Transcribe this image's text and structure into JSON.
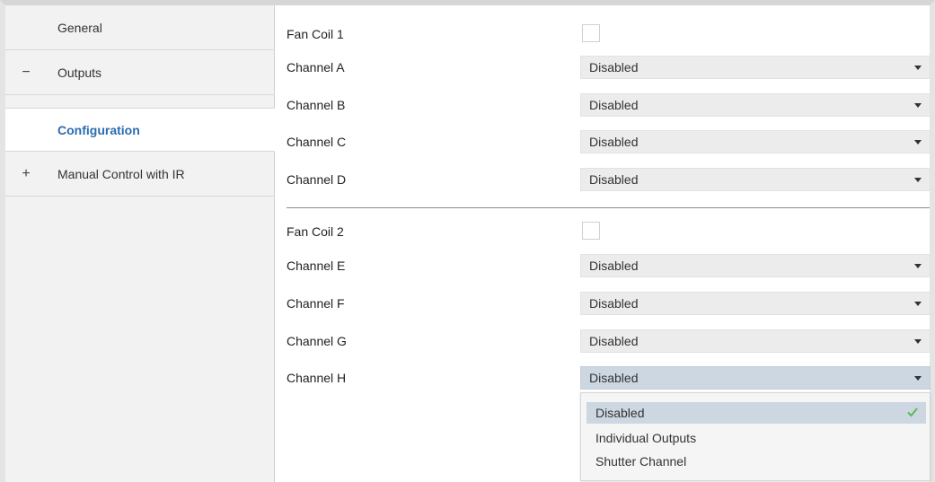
{
  "sidebar": {
    "items": [
      {
        "sign": "",
        "label": "General"
      },
      {
        "sign": "−",
        "label": "Outputs"
      },
      {
        "sign": "",
        "label": "Configuration"
      },
      {
        "sign": "+",
        "label": "Manual Control with IR"
      }
    ]
  },
  "main": {
    "fan_coil_1": {
      "label": "Fan Coil 1",
      "checked": false
    },
    "channels_1": [
      {
        "label": "Channel A",
        "value": "Disabled"
      },
      {
        "label": "Channel B",
        "value": "Disabled"
      },
      {
        "label": "Channel C",
        "value": "Disabled"
      },
      {
        "label": "Channel D",
        "value": "Disabled"
      }
    ],
    "fan_coil_2": {
      "label": "Fan Coil 2",
      "checked": false
    },
    "channels_2": [
      {
        "label": "Channel E",
        "value": "Disabled"
      },
      {
        "label": "Channel F",
        "value": "Disabled"
      },
      {
        "label": "Channel G",
        "value": "Disabled"
      },
      {
        "label": "Channel H",
        "value": "Disabled"
      }
    ],
    "dropdown_options": [
      "Disabled",
      "Individual Outputs",
      "Shutter Channel"
    ],
    "dropdown_selected": "Disabled"
  },
  "colors": {
    "accent": "#2b6cb0",
    "selection": "#cdd7e1",
    "check": "#5cb85c"
  }
}
